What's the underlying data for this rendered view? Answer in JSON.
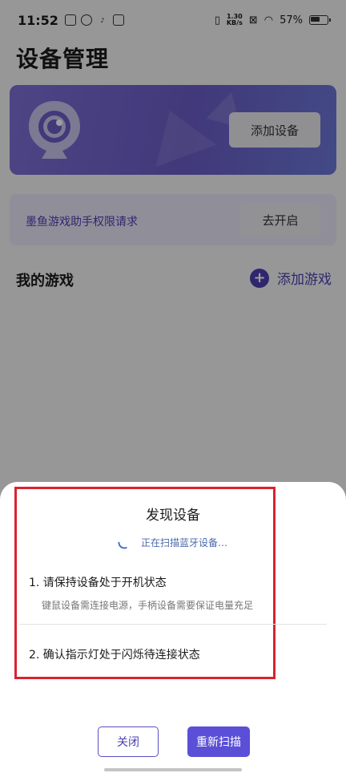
{
  "statusbar": {
    "time": "11:52",
    "speed_top": "1.30",
    "speed_bottom": "KB/s",
    "battery": "57%"
  },
  "page": {
    "title": "设备管理"
  },
  "device_card": {
    "add_device_label": "添加设备"
  },
  "permission": {
    "text": "墨鱼游戏助手权限请求",
    "button": "去开启"
  },
  "games": {
    "title": "我的游戏",
    "add_label": "添加游戏"
  },
  "sheet": {
    "title": "发现设备",
    "scanning": "正在扫描蓝牙设备…",
    "step1": "1. 请保持设备处于开机状态",
    "step1_desc": "键鼠设备需连接电源，手柄设备需要保证电量充足",
    "step2": "2. 确认指示灯处于闪烁待连接状态",
    "close_label": "关闭",
    "rescan_label": "重新扫描"
  },
  "colors": {
    "accent": "#4b3fb0",
    "highlight": "#d9232f",
    "card_gradient_start": "#7d6fd6"
  }
}
